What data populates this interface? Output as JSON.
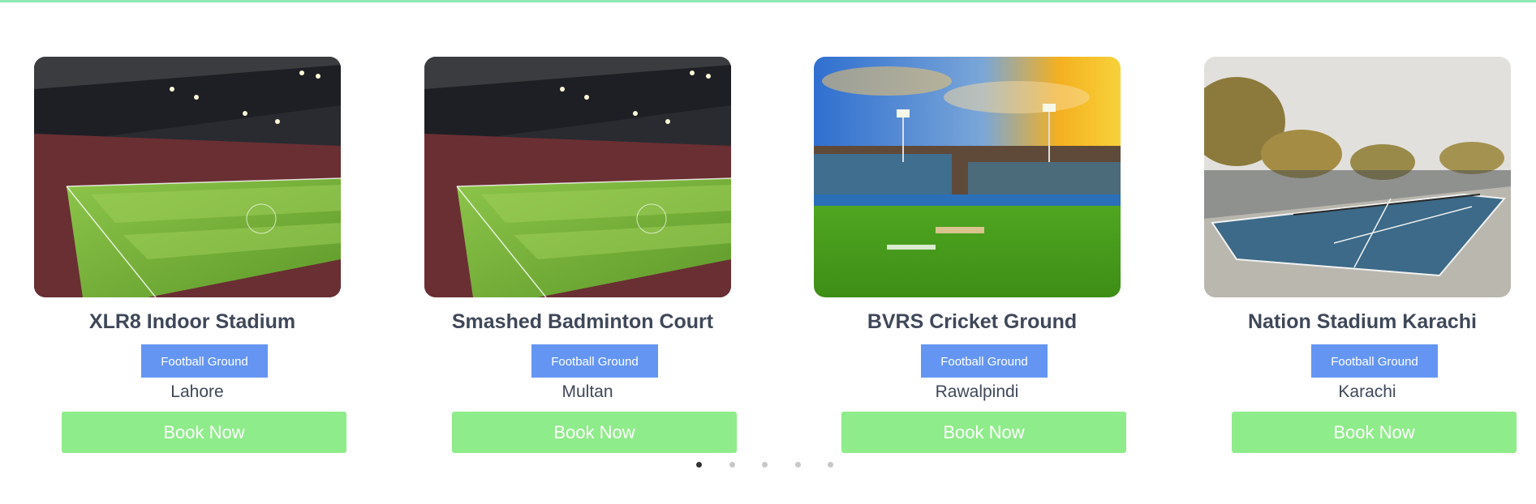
{
  "colors": {
    "top_line": "#8ee8b4",
    "title": "#3f4859",
    "type_badge": "#6495f2",
    "book_button": "#8fec8a",
    "dot_active": "#333333",
    "dot_inactive": "#c8c8c8"
  },
  "cards": [
    {
      "title": "XLR8 Indoor Stadium",
      "type": "Football Ground",
      "city": "Lahore",
      "book_label": "Book Now",
      "image": "football-stadium-photo"
    },
    {
      "title": "Smashed Badminton Court",
      "type": "Football Ground",
      "city": "Multan",
      "book_label": "Book Now",
      "image": "football-stadium-photo"
    },
    {
      "title": "BVRS Cricket Ground",
      "type": "Football Ground",
      "city": "Rawalpindi",
      "book_label": "Book Now",
      "image": "cricket-ground-sunset-photo"
    },
    {
      "title": "Nation Stadium Karachi",
      "type": "Football Ground",
      "city": "Karachi",
      "book_label": "Book Now",
      "image": "tennis-court-photo"
    }
  ],
  "pagination": {
    "total": 5,
    "active": 1
  }
}
